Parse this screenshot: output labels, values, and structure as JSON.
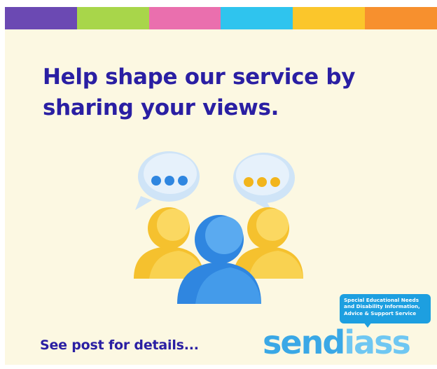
{
  "stripe_colors": [
    "#6b49b3",
    "#a8d64a",
    "#ea6fae",
    "#2fc4ee",
    "#fbc62b",
    "#f7902e"
  ],
  "headline": {
    "line1": "Help shape our service by",
    "line2": "sharing your views."
  },
  "footer": {
    "text": "See post for details..."
  },
  "logo": {
    "tagline": {
      "line1": "Special Educational Needs",
      "line2": "and Disability Information,",
      "line3": "Advice & Support Service"
    },
    "word_part1": "send",
    "word_part2": "iass"
  },
  "icons": [
    "speech-bubble-blue-dots",
    "speech-bubble-yellow-dots",
    "person-yellow-left",
    "person-yellow-right",
    "person-blue-front"
  ],
  "colors": {
    "background": "#fcf8e2",
    "headline": "#2a1fa3",
    "logo_blue": "#3aa8e6",
    "logo_light_blue": "#6fc7f2"
  }
}
